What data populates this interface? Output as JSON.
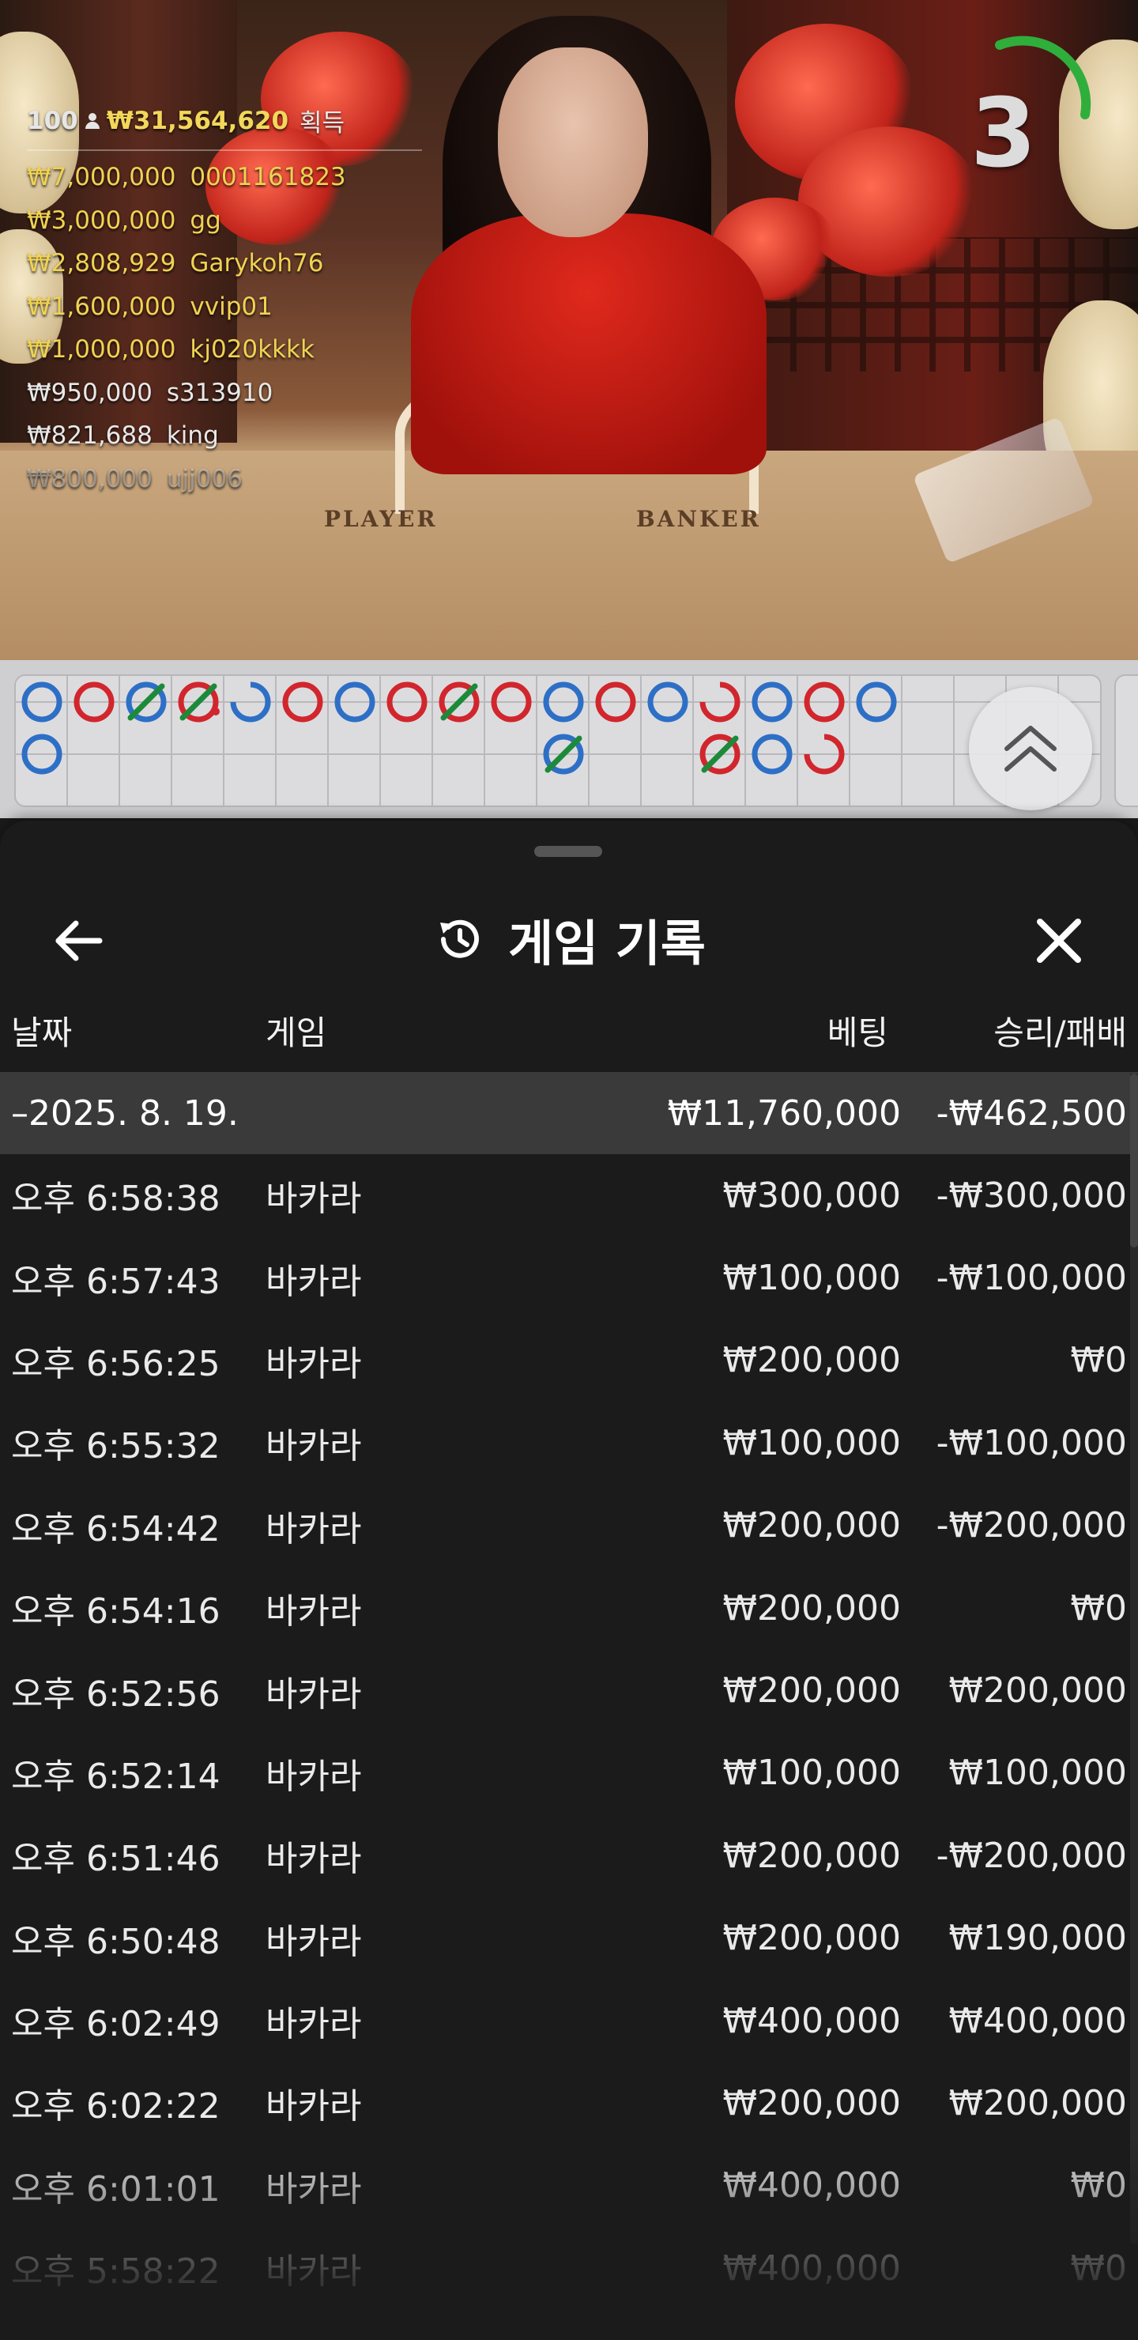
{
  "leaderboard": {
    "player_count": "100",
    "total_amount": "₩31,564,620",
    "won_label": "획득",
    "entries": [
      {
        "amount": "₩7,000,000",
        "name": "0001161823"
      },
      {
        "amount": "₩3,000,000",
        "name": "gg"
      },
      {
        "amount": "₩2,808,929",
        "name": "Garykoh76"
      },
      {
        "amount": "₩1,600,000",
        "name": "vvip01"
      },
      {
        "amount": "₩1,000,000",
        "name": "kj020kkkk"
      },
      {
        "amount": "₩950,000",
        "name": "s313910"
      },
      {
        "amount": "₩821,688",
        "name": "king"
      },
      {
        "amount": "₩800,000",
        "name": "ujj006"
      }
    ]
  },
  "table_labels": {
    "player": "PLAYER",
    "banker": "BANKER"
  },
  "timer": {
    "value": "3",
    "ring_color": "#2fae3c"
  },
  "colors": {
    "player": "#2e6fc6",
    "banker": "#d1262d",
    "tie": "#1d8a3a",
    "sheet_bg": "#1b1b1c",
    "gold": "#f0d253"
  },
  "road": {
    "beads": [
      {
        "col": 0,
        "row": 0,
        "type": "player"
      },
      {
        "col": 1,
        "row": 0,
        "type": "banker"
      },
      {
        "col": 2,
        "row": 0,
        "type": "player",
        "tie": true
      },
      {
        "col": 3,
        "row": 0,
        "type": "banker",
        "tie": true,
        "pair": true
      },
      {
        "col": 4,
        "row": 0,
        "type": "player",
        "partial": true
      },
      {
        "col": 5,
        "row": 0,
        "type": "banker"
      },
      {
        "col": 6,
        "row": 0,
        "type": "player"
      },
      {
        "col": 7,
        "row": 0,
        "type": "banker"
      },
      {
        "col": 8,
        "row": 0,
        "type": "banker",
        "tie": true
      },
      {
        "col": 9,
        "row": 0,
        "type": "banker"
      },
      {
        "col": 10,
        "row": 0,
        "type": "player"
      },
      {
        "col": 11,
        "row": 0,
        "type": "banker"
      },
      {
        "col": 12,
        "row": 0,
        "type": "player"
      },
      {
        "col": 13,
        "row": 0,
        "type": "banker",
        "partial": true
      },
      {
        "col": 14,
        "row": 0,
        "type": "player"
      },
      {
        "col": 15,
        "row": 0,
        "type": "banker"
      },
      {
        "col": 16,
        "row": 0,
        "type": "player"
      },
      {
        "col": 0,
        "row": 1,
        "type": "player"
      },
      {
        "col": 10,
        "row": 1,
        "type": "player",
        "tie": true
      },
      {
        "col": 13,
        "row": 1,
        "type": "banker",
        "tie": true
      },
      {
        "col": 14,
        "row": 1,
        "type": "player"
      },
      {
        "col": 15,
        "row": 1,
        "type": "banker",
        "partial": true
      }
    ]
  },
  "sheet": {
    "title": "게임 기록",
    "icons": {
      "back": "arrow-left-icon",
      "history": "history-icon",
      "close": "close-icon"
    },
    "columns": {
      "date": "날짜",
      "game": "게임",
      "bet": "베팅",
      "winloss": "승리/패배"
    },
    "date_group": {
      "label": "–2025. 8. 19.",
      "bet": "₩11,760,000",
      "winloss": "-₩462,500"
    },
    "rows": [
      {
        "time": "오후 6:58:38",
        "game": "바카라",
        "bet": "₩300,000",
        "winloss": "-₩300,000"
      },
      {
        "time": "오후 6:57:43",
        "game": "바카라",
        "bet": "₩100,000",
        "winloss": "-₩100,000"
      },
      {
        "time": "오후 6:56:25",
        "game": "바카라",
        "bet": "₩200,000",
        "winloss": "₩0"
      },
      {
        "time": "오후 6:55:32",
        "game": "바카라",
        "bet": "₩100,000",
        "winloss": "-₩100,000"
      },
      {
        "time": "오후 6:54:42",
        "game": "바카라",
        "bet": "₩200,000",
        "winloss": "-₩200,000"
      },
      {
        "time": "오후 6:54:16",
        "game": "바카라",
        "bet": "₩200,000",
        "winloss": "₩0"
      },
      {
        "time": "오후 6:52:56",
        "game": "바카라",
        "bet": "₩200,000",
        "winloss": "₩200,000"
      },
      {
        "time": "오후 6:52:14",
        "game": "바카라",
        "bet": "₩100,000",
        "winloss": "₩100,000"
      },
      {
        "time": "오후 6:51:46",
        "game": "바카라",
        "bet": "₩200,000",
        "winloss": "-₩200,000"
      },
      {
        "time": "오후 6:50:48",
        "game": "바카라",
        "bet": "₩200,000",
        "winloss": "₩190,000"
      },
      {
        "time": "오후 6:02:49",
        "game": "바카라",
        "bet": "₩400,000",
        "winloss": "₩400,000"
      },
      {
        "time": "오후 6:02:22",
        "game": "바카라",
        "bet": "₩200,000",
        "winloss": "₩200,000"
      },
      {
        "time": "오후 6:01:01",
        "game": "바카라",
        "bet": "₩400,000",
        "winloss": "₩0"
      },
      {
        "time": "오후 5:58:22",
        "game": "바카라",
        "bet": "₩400,000",
        "winloss": "₩0"
      }
    ]
  }
}
